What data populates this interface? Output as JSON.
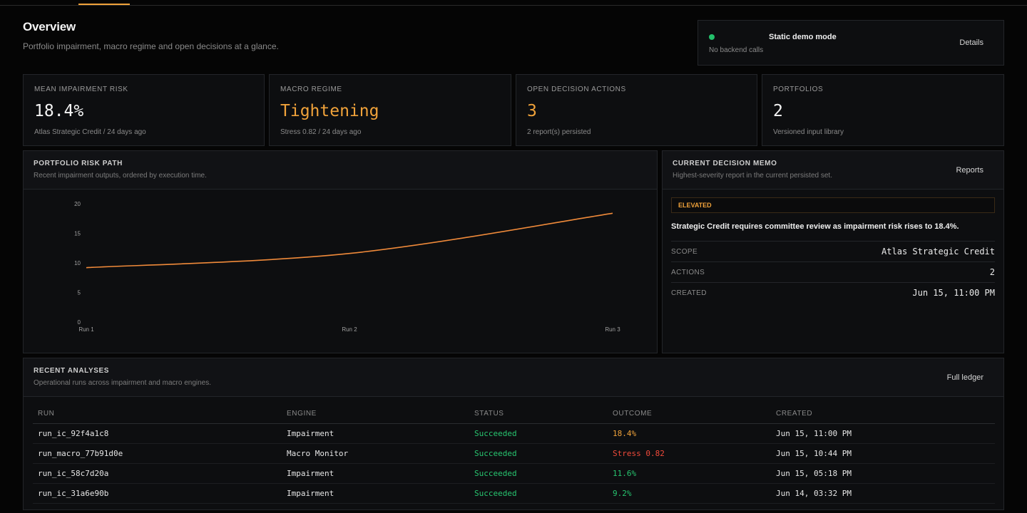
{
  "page": {
    "title": "Overview",
    "subtitle": "Portfolio impairment, macro regime and open decisions at a glance."
  },
  "demo": {
    "title": "Static demo mode",
    "subtitle": "No backend calls",
    "details_label": "Details",
    "status_color": "#23c06b"
  },
  "stats": [
    {
      "label": "MEAN IMPAIRMENT RISK",
      "value": "18.4%",
      "note": "Atlas Strategic Credit / 24 days ago"
    },
    {
      "label": "MACRO REGIME",
      "value": "Tightening",
      "note": "Stress 0.82 / 24 days ago"
    },
    {
      "label": "OPEN DECISION ACTIONS",
      "value": "3",
      "note": "2 report(s) persisted"
    },
    {
      "label": "PORTFOLIOS",
      "value": "2",
      "note": "Versioned input library"
    }
  ],
  "risk_path": {
    "title": "PORTFOLIO RISK PATH",
    "subtitle": "Recent impairment outputs, ordered by execution time."
  },
  "chart_data": {
    "type": "line",
    "categories": [
      "Run 1",
      "Run 2",
      "Run 3"
    ],
    "values": [
      9.2,
      11.6,
      18.4
    ],
    "yticks": [
      0,
      5,
      10,
      15,
      20
    ],
    "ylim": [
      0,
      20
    ],
    "line_color": "#f08a3a",
    "title": "",
    "xlabel": "",
    "ylabel": ""
  },
  "memo": {
    "title": "CURRENT DECISION MEMO",
    "subtitle": "Highest-severity report in the current persisted set.",
    "link_label": "Reports",
    "badge": "ELEVATED",
    "headline": "Strategic Credit requires committee review as impairment risk rises to 18.4%.",
    "rows": [
      {
        "key": "SCOPE",
        "value": "Atlas Strategic Credit"
      },
      {
        "key": "ACTIONS",
        "value": "2"
      },
      {
        "key": "CREATED",
        "value": "Jun 15, 11:00 PM"
      }
    ]
  },
  "recent": {
    "title": "RECENT ANALYSES",
    "subtitle": "Operational runs across impairment and macro engines.",
    "link_label": "Full ledger",
    "columns": [
      "RUN",
      "ENGINE",
      "STATUS",
      "OUTCOME",
      "CREATED"
    ],
    "rows": [
      {
        "run": "run_ic_92f4a1c8",
        "engine": "Impairment",
        "status": "Succeeded",
        "outcome": "18.4%",
        "created": "Jun 15, 11:00 PM"
      },
      {
        "run": "run_macro_77b91d0e",
        "engine": "Macro Monitor",
        "status": "Succeeded",
        "outcome": "Stress 0.82",
        "created": "Jun 15, 10:44 PM"
      },
      {
        "run": "run_ic_58c7d20a",
        "engine": "Impairment",
        "status": "Succeeded",
        "outcome": "11.6%",
        "created": "Jun 15, 05:18 PM"
      },
      {
        "run": "run_ic_31a6e90b",
        "engine": "Impairment",
        "status": "Succeeded",
        "outcome": "9.2%",
        "created": "Jun 14, 03:32 PM"
      }
    ]
  }
}
